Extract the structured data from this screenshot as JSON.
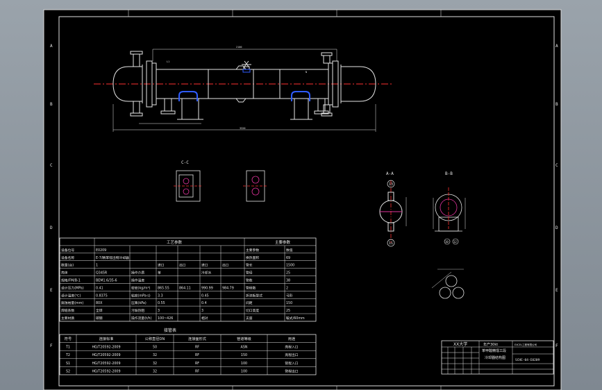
{
  "section_labels": {
    "cc": "C-C",
    "aa": "A-A",
    "bb": "B-B"
  },
  "nozzle_callouts": {
    "a_top": "13",
    "a_bot": "11",
    "b_left": "10",
    "b_right": "12"
  },
  "border_letters": [
    "A",
    "B",
    "C",
    "D",
    "E",
    "F"
  ],
  "spec_table": {
    "col_headers": {
      "process": "工艺参数",
      "params": "主要参数",
      "shell": "壳程",
      "tube": "管程"
    },
    "rows": [
      [
        "设备位号",
        "E0209",
        "",
        "",
        "",
        "",
        "",
        "主要参数",
        "数值"
      ],
      [
        "设备名称",
        "E-7/精苯馏出物冷却器",
        "",
        "",
        "",
        "",
        "",
        "换热面积",
        "69"
      ],
      [
        "数量(台)",
        "1",
        "",
        "进口",
        "出口",
        "进口",
        "出口",
        "管长",
        "1500"
      ],
      [
        "壳体",
        "Q345R",
        "操作介质",
        "苯",
        "",
        "冷却水",
        "",
        "管径",
        "25"
      ],
      [
        "规格/FM/B-1",
        "BEM1.6/35-6",
        "操作温度",
        "",
        "",
        "",
        "",
        "管数",
        "38"
      ],
      [
        "设计压力(MPa)",
        "0.41",
        "密度(kg/m³)",
        "865.55",
        "864.11",
        "990.99",
        "984.79",
        "管程数",
        "2"
      ],
      [
        "设计温度(℃)",
        "0.8375",
        "粘度(mPa·s)",
        "3.3",
        "",
        "0.45",
        "",
        "折流板型式",
        "弓形"
      ],
      [
        "腐蚀裕量(mm)",
        "80X",
        "压降(kPa)",
        "0.55",
        "",
        "0.4",
        "",
        "间距",
        "150"
      ],
      [
        "焊缝系数",
        "全焊",
        "污垢热阻",
        "3",
        "",
        "3",
        "",
        "切口高度",
        "25"
      ],
      [
        "主要材质",
        "碳钢",
        "操作流量(t/h)",
        "100~426",
        "",
        "相对",
        "",
        "支座",
        "鞍式/60mm"
      ]
    ]
  },
  "nozzle_table": {
    "title": "接管表",
    "headers": [
      "符号",
      "连接标准",
      "公称直径DN",
      "连接面形式",
      "管道等级",
      "用途"
    ],
    "rows": [
      [
        "T1",
        "HG/T20592-2009",
        "50",
        "RF",
        "ASN",
        "壳程入口"
      ],
      [
        "T2",
        "HG/T20592-2009",
        "32",
        "RF",
        "150",
        "壳程出口"
      ],
      [
        "S1",
        "HG/T20592-2009",
        "32",
        "RF",
        "100",
        "管程入口"
      ],
      [
        "S2",
        "HG/T20592-2009",
        "32",
        "RF",
        "100",
        "管程出口"
      ]
    ]
  },
  "title_block": {
    "school": "XX大学",
    "title_line1": "年产30kt",
    "title_line2": "苯甲酸精馏工段",
    "title_line3": "冷却器结构图",
    "drawing_no": "SCHE-04-E0209",
    "company": "EXCEL工程有限公司"
  }
}
